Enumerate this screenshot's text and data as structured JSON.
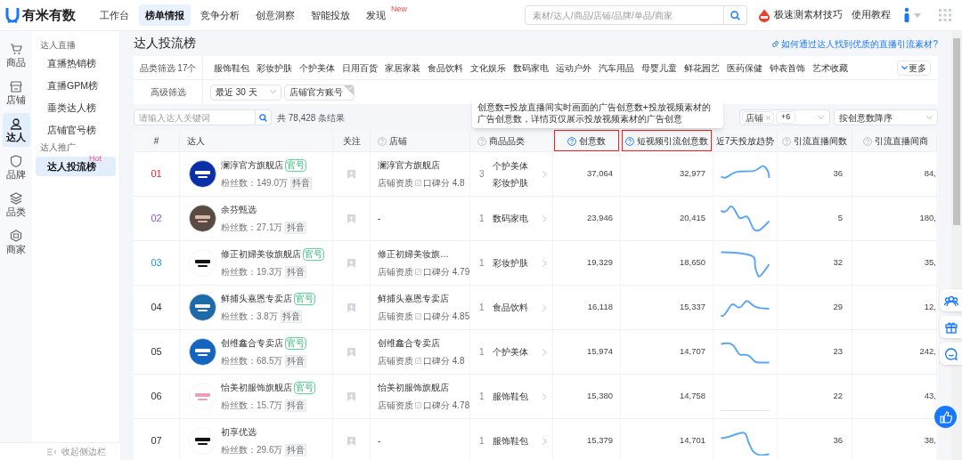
{
  "header": {
    "logo": "有米有数",
    "nav": [
      {
        "label": "工作台",
        "selected": false
      },
      {
        "label": "榜单情报",
        "selected": true
      },
      {
        "label": "竞争分析",
        "selected": false
      },
      {
        "label": "创意洞察",
        "selected": false
      },
      {
        "label": "智能投放",
        "selected": false
      },
      {
        "label": "发现",
        "selected": false,
        "badge": "New"
      }
    ],
    "search": {
      "placeholder": "素材/达人/商品/店铺/品牌/单品/商家"
    },
    "tips_link": "极速测素材技巧",
    "tutorial": "使用教程"
  },
  "rail": [
    {
      "label": "商品",
      "selected": false
    },
    {
      "label": "店铺",
      "selected": false
    },
    {
      "label": "达人",
      "selected": true
    },
    {
      "label": "品牌",
      "selected": false
    },
    {
      "label": "品类",
      "selected": false
    },
    {
      "label": "商家",
      "selected": false
    }
  ],
  "sidebar": {
    "groups": [
      {
        "title": "达人直播",
        "items": [
          {
            "label": "直播热销榜",
            "selected": false
          },
          {
            "label": "直播GPM榜",
            "selected": false
          },
          {
            "label": "垂类达人榜",
            "selected": false
          },
          {
            "label": "店铺官号榜",
            "selected": false
          }
        ]
      },
      {
        "title": "达人推广",
        "items": [
          {
            "label": "达人投流榜",
            "selected": true,
            "badge": "Hot"
          }
        ]
      }
    ],
    "collapse": "收起侧边栏"
  },
  "page": {
    "title": "达人投流榜",
    "help_link": "如何通过达人找到优质的直播引流素材?"
  },
  "filters": {
    "category_label": "品类筛选 17个",
    "categories": [
      "服饰鞋包",
      "彩妆护肤",
      "个护美体",
      "日用百货",
      "家居家装",
      "食品饮料",
      "文化娱乐",
      "数码家电",
      "运动户外",
      "汽车用品",
      "母婴儿童",
      "鲜花园艺",
      "医药保健",
      "钟表首饰",
      "艺术收藏"
    ],
    "more": "更多",
    "advanced_label": "高级筛选",
    "period": "最近 30 天",
    "official_account": {
      "label": "店铺官方账号",
      "checked": false
    }
  },
  "toolbar": {
    "search_placeholder": "请输入达人关键词",
    "result_count": "共 78,428 条结果",
    "tag": "店铺",
    "tag_more": "+6",
    "sort": "按创意数降序"
  },
  "tooltip": "创意数=投放直播间实时画面的广告创意数+投放视频素材的广告创意数，详情页仅展示投放视频素材的广告创意",
  "table": {
    "columns": [
      {
        "label": "#",
        "help": false,
        "highlighted": false
      },
      {
        "label": "达人",
        "help": false,
        "highlighted": false
      },
      {
        "label": "关注",
        "help": false,
        "highlighted": false
      },
      {
        "label": "店铺",
        "help": true,
        "highlighted": false
      },
      {
        "label": "商品品类",
        "help": true,
        "highlighted": false
      },
      {
        "label": "创意数",
        "help": true,
        "highlighted": true
      },
      {
        "label": "短视频引流创意数",
        "help": true,
        "highlighted": true
      },
      {
        "label": "近7天投放趋势",
        "help": false,
        "highlighted": false
      },
      {
        "label": "引流直播间数",
        "help": true,
        "highlighted": false
      },
      {
        "label": "引流直播间商",
        "help": true,
        "highlighted": false
      }
    ],
    "rows": [
      {
        "rank": "01",
        "color": "#f5222d",
        "name": "澜淳官方旗舰店",
        "official": "官号",
        "fans": "粉丝数：149.0万",
        "platform": "抖音",
        "store": "澜淳官方旗舰店",
        "store_cert": "店铺资质",
        "rating": "口碑分 4.8",
        "cat_count": "3",
        "cats": [
          "个护美体",
          "彩妆护肤"
        ],
        "ideas": "37,064",
        "short_ideas": "32,977",
        "rooms": "36",
        "col_10": "84,"
      },
      {
        "rank": "02",
        "color": "#9254de",
        "name": "余芬甄选",
        "fans": "粉丝数：27.1万",
        "platform": "抖音",
        "store": "-",
        "cat_count": "1",
        "cats": [
          "数码家电"
        ],
        "ideas": "23,946",
        "short_ideas": "20,415",
        "rooms": "5",
        "col_10": "180,"
      },
      {
        "rank": "03",
        "color": "#1890ff",
        "name": "修正初婦美妆旗舰店",
        "official": "官号",
        "fans": "粉丝数：19.3万",
        "platform": "抖音",
        "store": "修正初婦美妆旗…",
        "store_cert": "店铺资质",
        "rating": "口碑分 4.79",
        "cat_count": "1",
        "cats": [
          "彩妆护肤"
        ],
        "ideas": "19,329",
        "short_ideas": "18,650",
        "rooms": "32",
        "col_10": "35,"
      },
      {
        "rank": "04",
        "name": "鲜捕头嘉恩专卖店",
        "official": "官号",
        "fans": "粉丝数：3.8万",
        "platform": "抖音",
        "store": "鲜捕头嘉恩专卖店",
        "store_cert": "店铺资质",
        "rating": "口碑分 4.85",
        "cat_count": "1",
        "cats": [
          "食品饮料"
        ],
        "ideas": "16,118",
        "short_ideas": "15,337",
        "rooms": "29",
        "col_10": "12,"
      },
      {
        "rank": "05",
        "name": "创维鑫合专卖店",
        "official": "官号",
        "fans": "粉丝数：68.5万",
        "platform": "抖音",
        "store": "创维鑫合专卖店",
        "store_cert": "店铺资质",
        "rating": "口碑分 4.8",
        "cat_count": "1",
        "cats": [
          "个护美体"
        ],
        "ideas": "15,974",
        "short_ideas": "14,707",
        "rooms": "23",
        "col_10": "242,"
      },
      {
        "rank": "06",
        "name": "怡美初服饰旗舰店",
        "official": "官号",
        "fans": "粉丝数：15.7万",
        "platform": "抖音",
        "store": "怡美初服饰旗舰店",
        "store_cert": "店铺资质",
        "rating": "口碑分 4.78",
        "cat_count": "1",
        "cats": [
          "服饰鞋包"
        ],
        "ideas": "15,380",
        "short_ideas": "14,758",
        "rooms": "22",
        "col_10": "43,"
      },
      {
        "rank": "07",
        "name": "初享优选",
        "fans": "粉丝数：29.6万",
        "platform": "抖音",
        "store": "-",
        "cat_count": "1",
        "cats": [
          "服饰鞋包"
        ],
        "ideas": "15,379",
        "short_ideas": "14,701",
        "rooms": "36",
        "col_10": "38,"
      }
    ]
  }
}
